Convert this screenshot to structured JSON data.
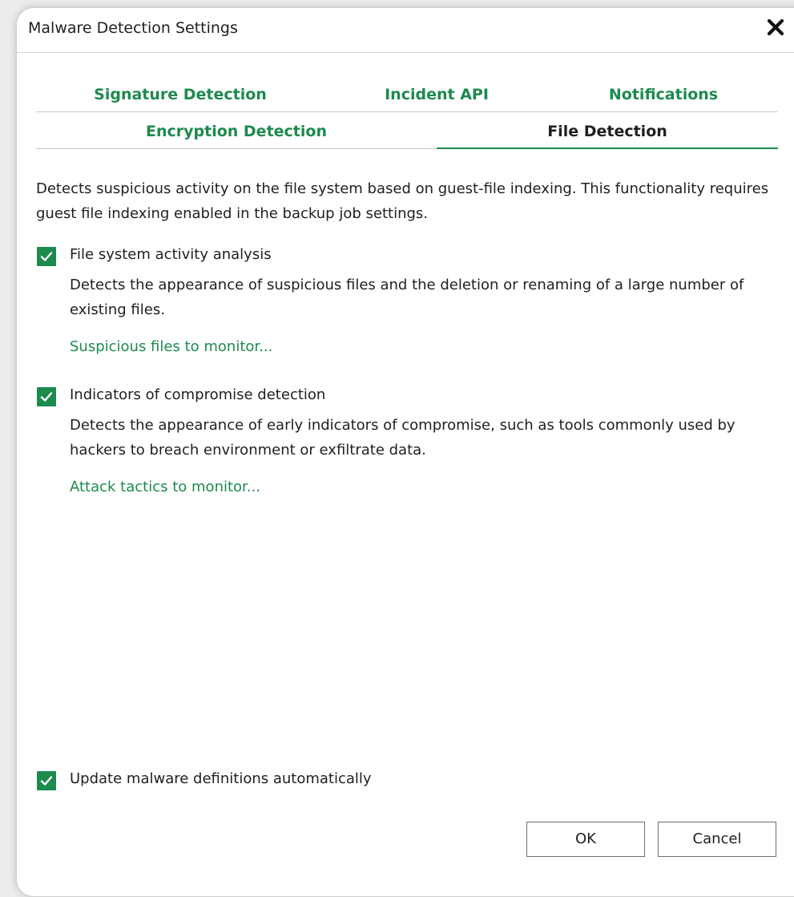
{
  "dialog": {
    "title": "Malware Detection Settings",
    "close_icon": "close-icon"
  },
  "tabs": [
    {
      "label": "Signature Detection",
      "active": false
    },
    {
      "label": "Incident API",
      "active": false
    },
    {
      "label": "Notifications",
      "active": false
    },
    {
      "label": "Encryption Detection",
      "active": false
    },
    {
      "label": "File Detection",
      "active": true
    }
  ],
  "content": {
    "description": "Detects suspicious activity on the file system based on guest-file indexing. This functionality requires guest file indexing enabled in the backup job settings.",
    "options": [
      {
        "label": "File system activity analysis",
        "checked": true,
        "description": "Detects the appearance of suspicious files and the deletion or renaming of a large number of existing files.",
        "link": "Suspicious files to monitor..."
      },
      {
        "label": "Indicators of compromise detection",
        "checked": true,
        "description": "Detects the appearance of early indicators of compromise, such as tools commonly used by hackers to breach environment or exfiltrate data.",
        "link": "Attack tactics to monitor..."
      }
    ],
    "update_option": {
      "label": "Update malware definitions automatically",
      "checked": true
    }
  },
  "buttons": {
    "ok_label": "OK",
    "cancel_label": "Cancel"
  },
  "colors": {
    "accent": "#1d8a4e",
    "text": "#1f1f1f",
    "divider": "#c8c8c8"
  }
}
